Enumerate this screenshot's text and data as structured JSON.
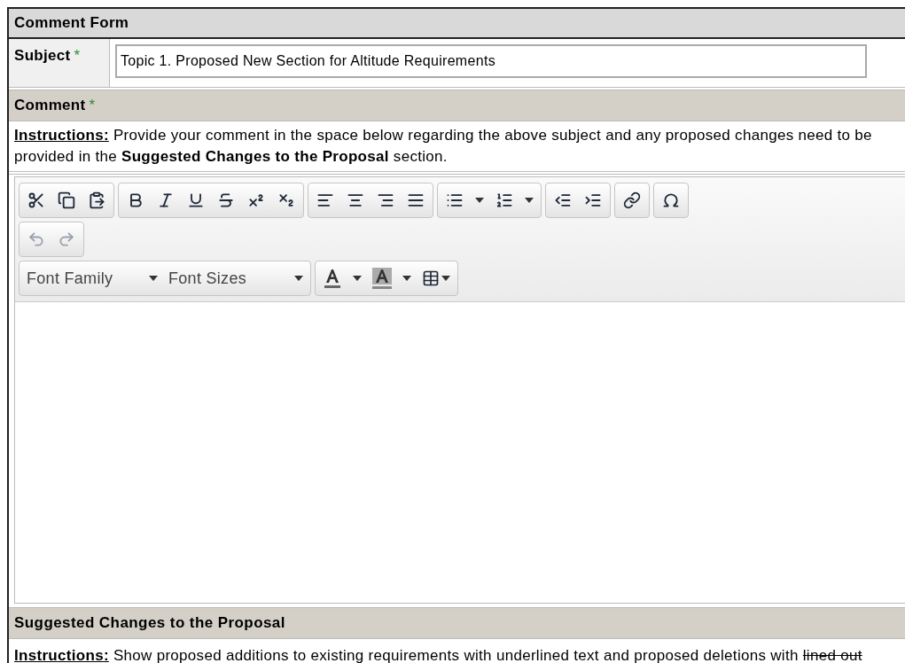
{
  "form": {
    "title": "Comment Form"
  },
  "subject": {
    "label": "Subject",
    "required_mark": "*",
    "value": "Topic 1. Proposed New Section for Altitude Requirements"
  },
  "comment": {
    "label": "Comment",
    "required_mark": "*",
    "instructions_label": "Instructions:",
    "instructions_text": "Provide your comment in the space below regarding the above subject and any proposed changes need to be provided in the **Suggested Changes to the Proposal** section.",
    "editor": {
      "font_family": "Font Family",
      "font_sizes": "Font Sizes"
    }
  },
  "suggested": {
    "title": "Suggested Changes to the Proposal",
    "instructions_label": "Instructions:",
    "instructions_text": "Show proposed additions to existing requirements with underlined text and proposed deletions with",
    "instructions_struck": "lined out"
  }
}
